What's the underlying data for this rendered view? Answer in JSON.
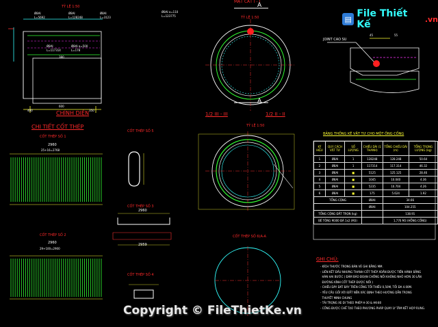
{
  "logo": {
    "brand": "File Thiết Kế",
    "suffix": ".vn"
  },
  "watermark": "Copyright © FileThietKe.vn",
  "views": {
    "elevation_scale": "TỶ LỆ 1:50",
    "section_top_title": "MẶT CẮT I - I",
    "section_top_scale": "TỶ LỆ 1:50",
    "chinh_dien": "CHÍNH DIỆN",
    "chi_tiet": "CHI TIẾT CỐT THÉP",
    "half_sections": "1/2 III - III",
    "half_sections_2": "1/2 II - II",
    "half_scale": "TỶ LỆ 1:50",
    "joint": "JOINT CAO SU",
    "section_a": "A",
    "cot_thep_1": "CỐT THÉP SỐ 1",
    "cot_thep_2": "CỐT THÉP SỐ 2",
    "cot_thep_3": "CỐT THÉP SỐ 3",
    "cot_thep_4": "CỐT THÉP SỐ 4",
    "cot_thep_5": "CỐT THÉP SỐ 5",
    "cot_thep_6a": "CỐT THÉP SỐ 6(A-A",
    "dim_2960": "2960",
    "dim_2959": "2959",
    "dim_2960b": "2960"
  },
  "bom_title": "BẢNG THỐNG KÊ VẬT TƯ CHO MỘT ỐNG CỐNG",
  "bom_headers": [
    "KÝ HIỆU",
    "QUY CÁCH VẬT TƯ",
    "SỐ LƯỢNG",
    "CHIỀU DÀI (1 THANH)",
    "TỔNG CHIỀU DÀI (m)",
    "TỔNG TRỌNG LƯỢNG (kg)"
  ],
  "bom_rows": [
    [
      "1",
      "Ø8AI",
      "1",
      "128248",
      "128.248",
      "50.64"
    ],
    [
      "2",
      "Ø8AI",
      "1",
      "117314",
      "117.314",
      "46.32"
    ],
    [
      "3",
      "Ø8AI",
      "■",
      "5125",
      "125.125",
      "28.46"
    ],
    [
      "4",
      "Ø8AI",
      "■",
      "1045",
      "10.040",
      "4.36"
    ],
    [
      "5",
      "Ø8AI",
      "■",
      "5235",
      "10.704",
      "4.26"
    ],
    [
      "6",
      "Ø8AI",
      "■",
      "175",
      "5.624",
      "1.92"
    ]
  ],
  "bom_totals": [
    [
      "TỔNG CỘNG",
      "Ø8AI",
      "34.66"
    ],
    [
      "",
      "Ø8AI",
      "104.255"
    ],
    [
      "TỔNG CỘNG ĐẤT TRỌN (kg)",
      "",
      "138.91"
    ],
    [
      "BÊ TÔNG M300 ĐÁ 1x2 (M3)",
      "",
      "1,776 M3 (HỖNG CỐNG)"
    ]
  ],
  "notes_title": "GHI CHÚ:",
  "notes": [
    "- KÍCH THƯỚC TRONG BẢN VẼ GHI BẰNG MM.",
    "- LIÊN KẾT ĐẦU NHƯNG THANH CỐT THÉP XOẮN ĐƯỢC TIẾN HÀNH BẰNG",
    "  HÀN HAI BƯỚC ( ĐẢM BẢO ĐOẠN CHỒNG NỐI KHÔNG NHỎ HƠN 30 LẦN",
    "  ĐƯỜNG KÍNH CỐT THÉP ĐƯỢC NỐI )",
    "- CHIỀU DÀY ĐÁT BẢY TRÊN CỐNG TỐI THIẾU 0,50M, TỐI ĐA 4.00M.",
    "- YÊU CẦU GỐI VỚI ĐẤT NỀN XÁC ĐỊNH THEO HƯỚNG DẪN TRONG",
    "  THUYẾT MINH CHUNG",
    "- TẢI TRỌNG XE ĐI THEO PHÉP H-30 & HK-80",
    "- CỐNG ĐƯỢC CHẾ TẠO THEO PHƯƠNG PHÁP QUAY LY TÂM KẾT HỢP RUNG."
  ],
  "labels": {
    "l1": "Ø8AI",
    "l2": "L=5692",
    "l3": "Ø8AI",
    "l4": "L=128248",
    "l5": "Ø8AI",
    "l6": "L=3123",
    "l7": "Ø8AI",
    "l8": "L=117314",
    "l9": "Ø8AI a=500",
    "l10": "L=178",
    "l11": "Ø8AI a=110",
    "l12": "L=123775",
    "d600": "600",
    "d380": "380",
    "d400": "400",
    "d350": "350",
    "d2960": "2960",
    "d25": "25+16=2768",
    "d29": "29+100=2900",
    "d45": "45",
    "d55": "55"
  }
}
